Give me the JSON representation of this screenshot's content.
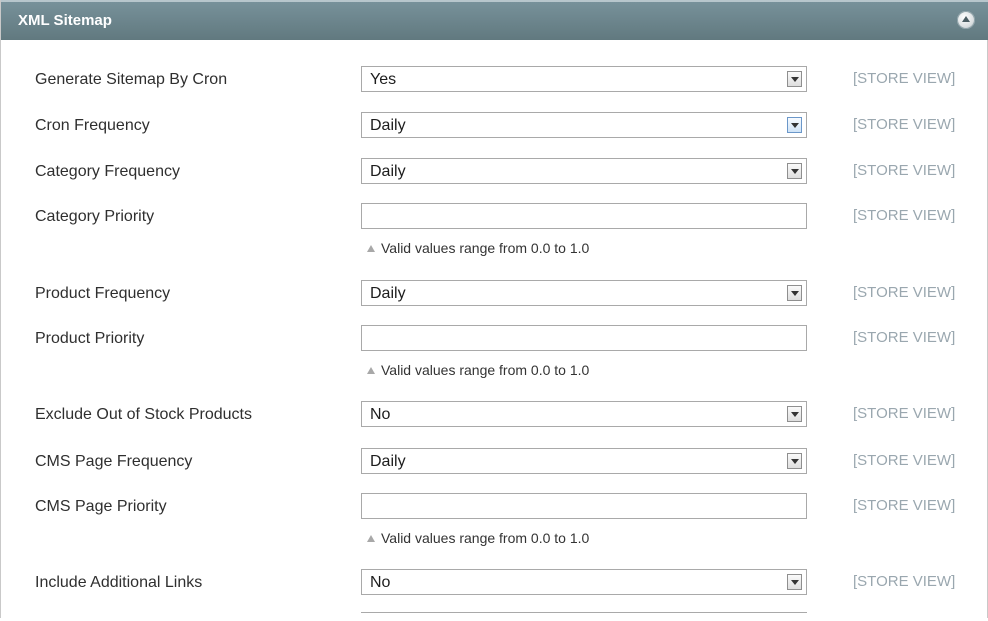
{
  "section": {
    "title": "XML Sitemap",
    "collapse_icon": "collapse-up-icon"
  },
  "fields": [
    {
      "label": "Generate Sitemap By Cron",
      "type": "select",
      "value": "Yes",
      "scope": "[STORE VIEW]"
    },
    {
      "label": "Cron Frequency",
      "type": "select",
      "value": "Daily",
      "scope": "[STORE VIEW]",
      "focused": true
    },
    {
      "label": "Category Frequency",
      "type": "select",
      "value": "Daily",
      "scope": "[STORE VIEW]"
    },
    {
      "label": "Category Priority",
      "type": "input",
      "value": "",
      "scope": "[STORE VIEW]",
      "note": "Valid values range from 0.0 to 1.0"
    },
    {
      "label": "Product Frequency",
      "type": "select",
      "value": "Daily",
      "scope": "[STORE VIEW]"
    },
    {
      "label": "Product Priority",
      "type": "input",
      "value": "",
      "scope": "[STORE VIEW]",
      "note": "Valid values range from 0.0 to 1.0"
    },
    {
      "label": "Exclude Out of Stock Products",
      "type": "select",
      "value": "No",
      "scope": "[STORE VIEW]"
    },
    {
      "label": "CMS Page Frequency",
      "type": "select",
      "value": "Daily",
      "scope": "[STORE VIEW]"
    },
    {
      "label": "CMS Page Priority",
      "type": "input",
      "value": "",
      "scope": "[STORE VIEW]",
      "note": "Valid values range from 0.0 to 1.0"
    },
    {
      "label": "Include Additional Links",
      "type": "select",
      "value": "No",
      "scope": "[STORE VIEW]"
    }
  ],
  "colors": {
    "header": "#6a8389",
    "scope_text": "#9aa7af"
  }
}
